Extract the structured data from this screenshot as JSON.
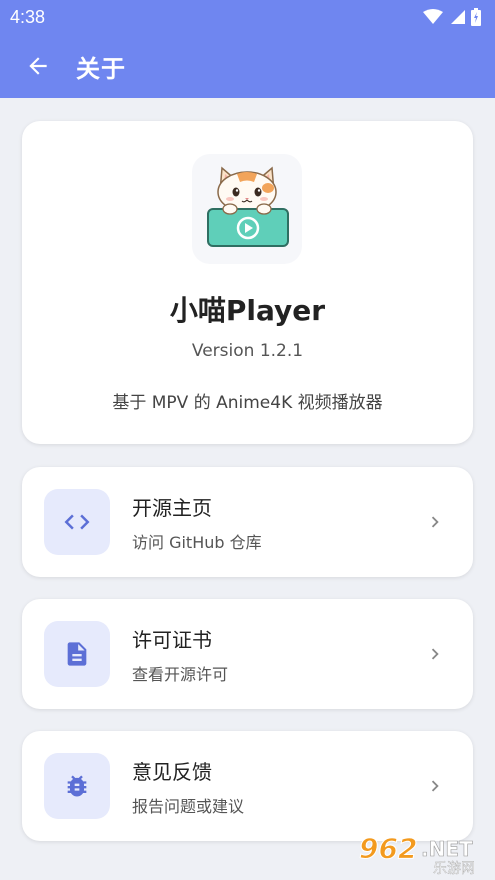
{
  "status_bar": {
    "time": "4:38"
  },
  "app_bar": {
    "title": "关于"
  },
  "app_info": {
    "name": "小喵Player",
    "version": "Version 1.2.1",
    "description": "基于 MPV 的 Anime4K 视频播放器"
  },
  "links": [
    {
      "title": "开源主页",
      "subtitle": "访问 GitHub 仓库",
      "icon": "code-icon"
    },
    {
      "title": "许可证书",
      "subtitle": "查看开源许可",
      "icon": "document-icon"
    },
    {
      "title": "意见反馈",
      "subtitle": "报告问题或建议",
      "icon": "bug-icon"
    }
  ],
  "watermark": {
    "text": "962.NET",
    "sub": "乐游网"
  },
  "colors": {
    "accent": "#6f86f0",
    "icon_tint": "#5c6fd6",
    "icon_bg": "#e6eafc",
    "background": "#eef0f5"
  }
}
